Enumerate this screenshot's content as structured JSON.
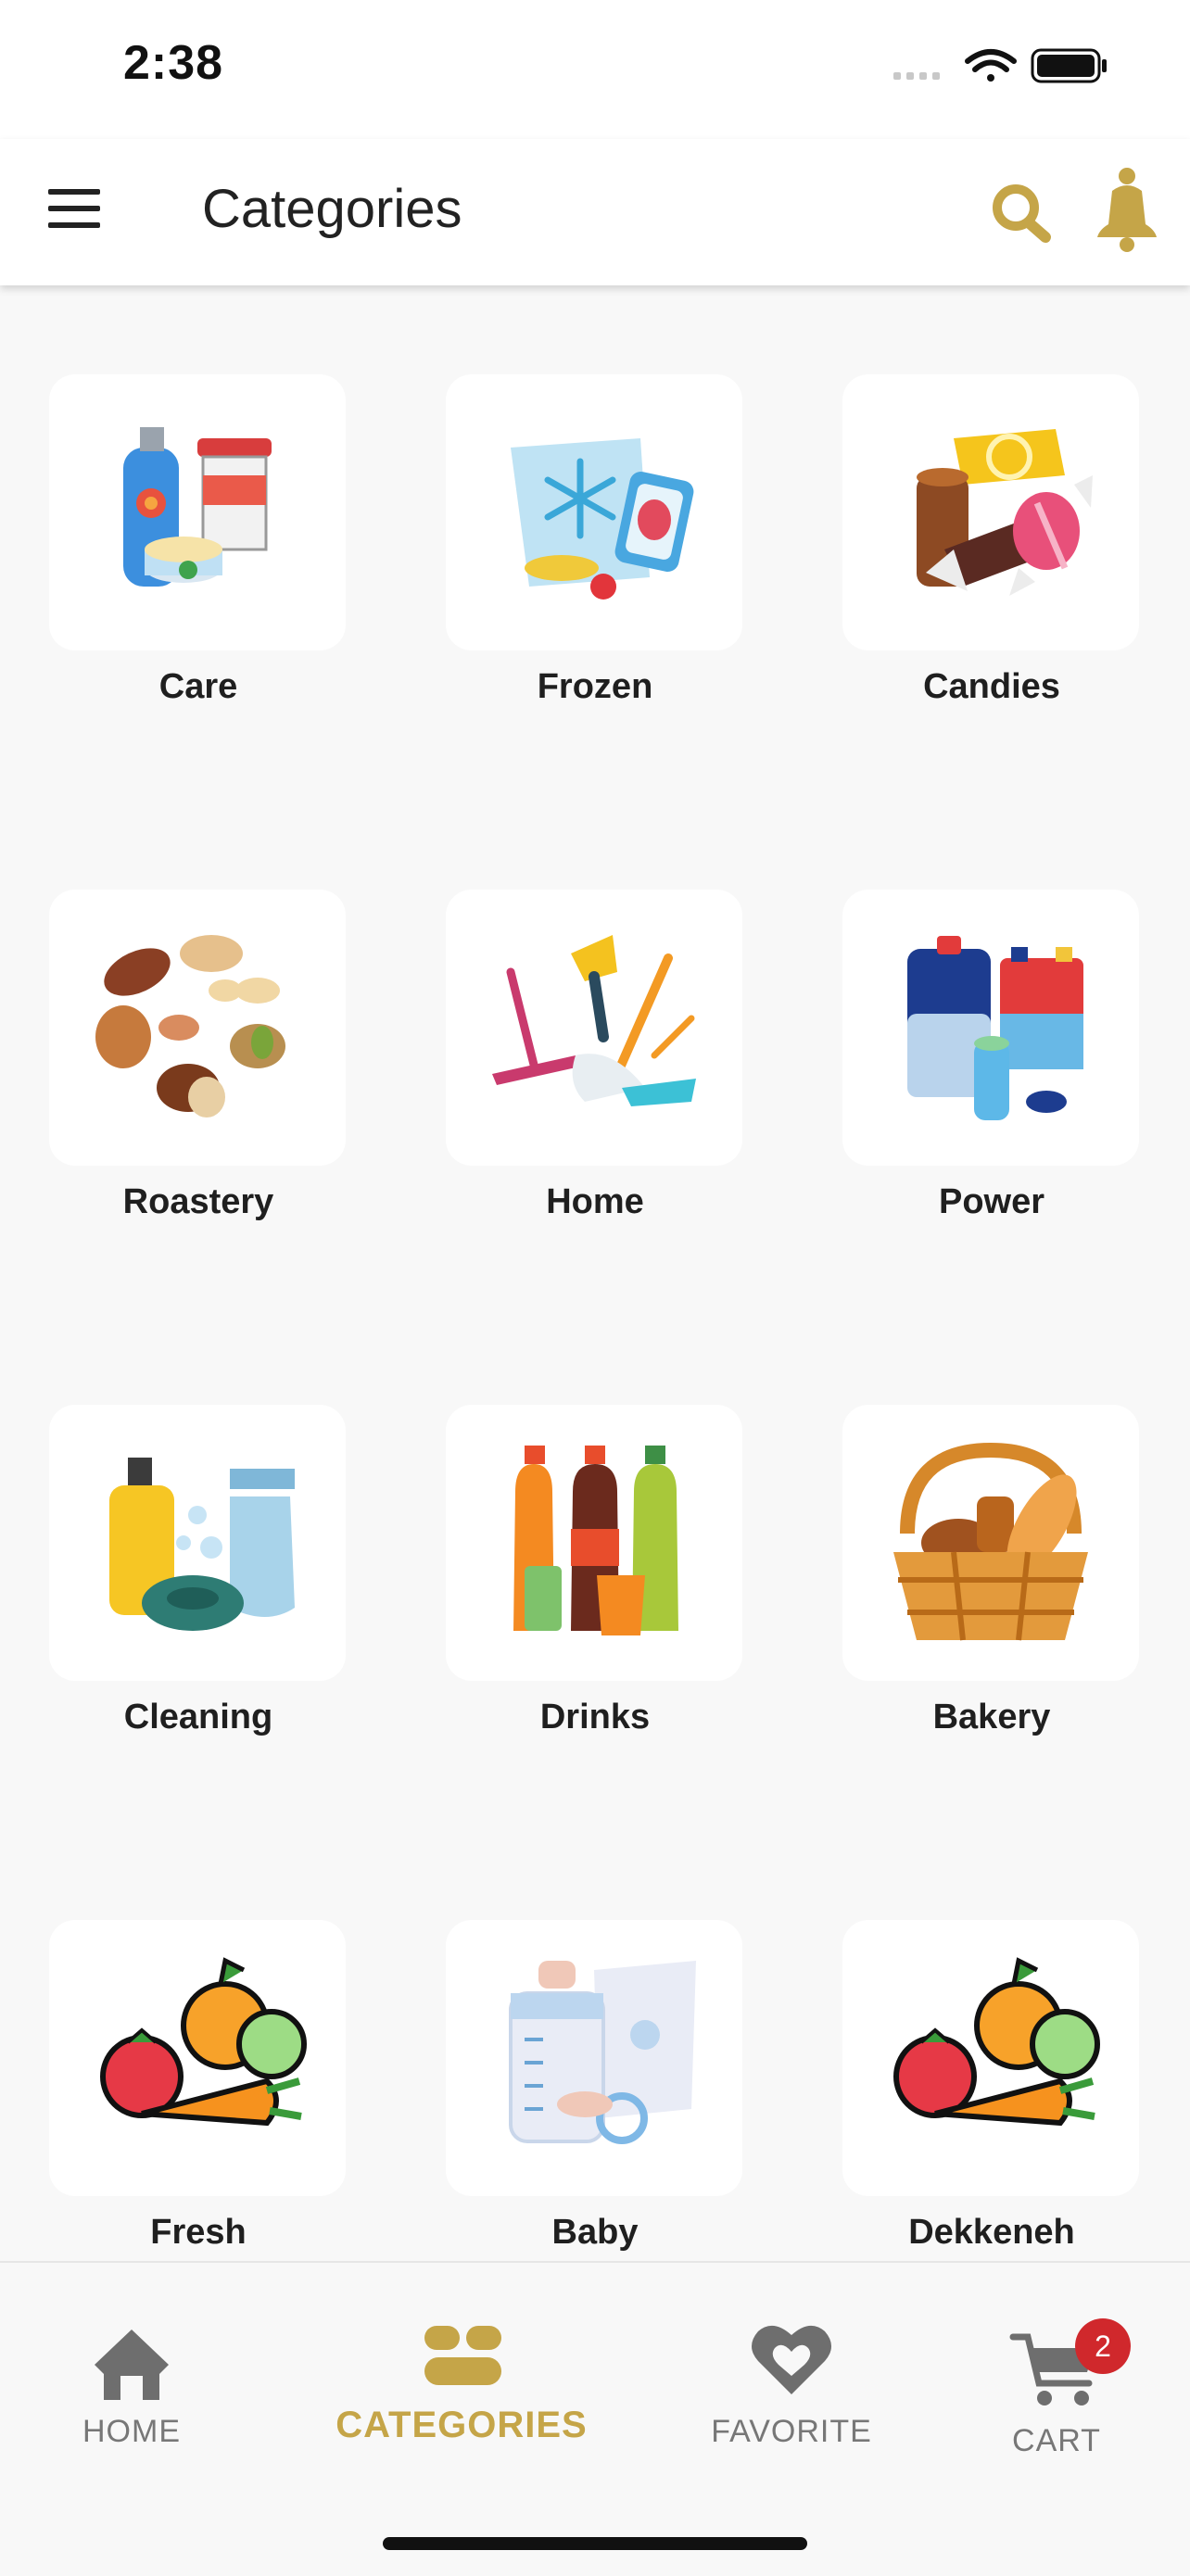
{
  "status_bar": {
    "time": "2:38"
  },
  "header": {
    "title": "Categories",
    "menu_icon": "hamburger-menu-icon",
    "search_icon": "search-icon",
    "bell_icon": "bell-icon"
  },
  "colors": {
    "accent": "#c5a548",
    "badge": "#d0282c",
    "background": "#f8f8f8"
  },
  "categories": [
    {
      "label": "Care",
      "icon": "care-products-icon"
    },
    {
      "label": "Frozen",
      "icon": "frozen-food-icon"
    },
    {
      "label": "Candies",
      "icon": "candies-icon"
    },
    {
      "label": "Roastery",
      "icon": "nuts-icon"
    },
    {
      "label": "Home",
      "icon": "home-tools-icon"
    },
    {
      "label": "Power",
      "icon": "batteries-icon"
    },
    {
      "label": "Cleaning",
      "icon": "cleaning-supplies-icon"
    },
    {
      "label": "Drinks",
      "icon": "bottles-icon"
    },
    {
      "label": "Bakery",
      "icon": "bread-basket-icon"
    },
    {
      "label": "Fresh",
      "icon": "vegetables-icon"
    },
    {
      "label": "Baby",
      "icon": "baby-supplies-icon"
    },
    {
      "label": "Dekkeneh",
      "icon": "vegetables-icon"
    }
  ],
  "bottom_nav": [
    {
      "label": "HOME",
      "icon": "home-icon",
      "active": false
    },
    {
      "label": "CATEGORIES",
      "icon": "categories-icon",
      "active": true
    },
    {
      "label": "FAVORITE",
      "icon": "heart-icon",
      "active": false
    },
    {
      "label": "CART",
      "icon": "cart-icon",
      "active": false,
      "badge": "2"
    }
  ]
}
